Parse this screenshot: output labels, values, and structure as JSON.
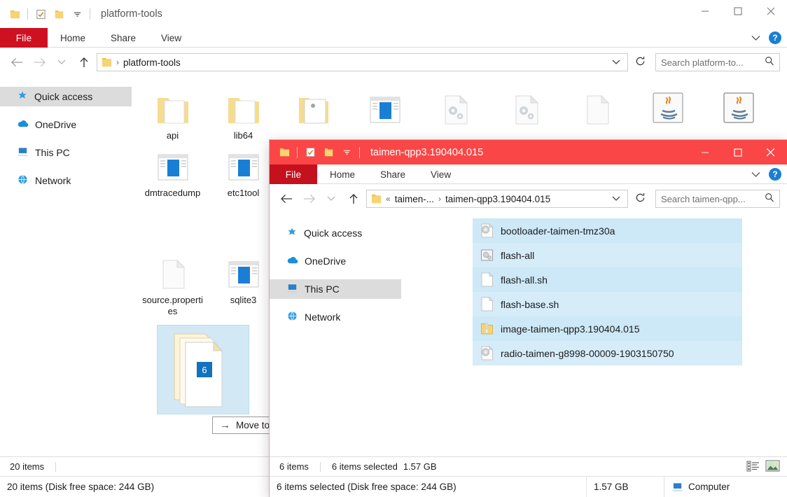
{
  "colors": {
    "accent_red_titlebar": "#fa4646",
    "file_tab_red": "#cf1020",
    "file_tab_red_front": "#c5101d",
    "selection_blue": "#cde8f7",
    "nav_selected_gray": "#dcdcdc"
  },
  "window_back": {
    "title": "platform-tools",
    "tabs": {
      "file": "File",
      "home": "Home",
      "share": "Share",
      "view": "View"
    },
    "controls": {
      "minimize": "–",
      "maximize": "□",
      "close": "✕"
    },
    "help_label": "?",
    "address": {
      "crumb_root_icon": "folder-icon",
      "separator": "›",
      "path": "platform-tools"
    },
    "search": {
      "placeholder": "Search platform-to..."
    },
    "nav": {
      "items": [
        {
          "label": "Quick access",
          "icon": "star-icon",
          "selected": true
        },
        {
          "label": "OneDrive",
          "icon": "cloud-icon",
          "selected": false
        },
        {
          "label": "This PC",
          "icon": "computer-icon",
          "selected": false
        },
        {
          "label": "Network",
          "icon": "network-icon",
          "selected": false
        }
      ]
    },
    "files": [
      {
        "name": "api",
        "icon": "folder-icon"
      },
      {
        "name": "lib64",
        "icon": "folder-icon"
      },
      {
        "name": "",
        "icon": "folder-open-icon"
      },
      {
        "name": "",
        "icon": "blue-book-icon"
      },
      {
        "name": "",
        "icon": "gears-document-icon"
      },
      {
        "name": "",
        "icon": "gears-document-icon"
      },
      {
        "name": "",
        "icon": "blank-document-icon"
      },
      {
        "name": "",
        "icon": "java-icon"
      },
      {
        "name": "",
        "icon": "java-icon"
      },
      {
        "name": "dmtracedump",
        "icon": "blue-book-icon"
      },
      {
        "name": "etc1tool",
        "icon": "blue-book-icon"
      },
      {
        "name": "source.properties",
        "icon": "blank-document-icon"
      },
      {
        "name": "sqlite3",
        "icon": "blue-book-icon"
      }
    ],
    "status": {
      "items_count": "20 items"
    },
    "taskbar": {
      "text": "20 items (Disk free space: 244 GB)"
    }
  },
  "window_front": {
    "title": "taimen-qpp3.190404.015",
    "tabs": {
      "file": "File",
      "home": "Home",
      "share": "Share",
      "view": "View"
    },
    "controls": {
      "minimize": "–",
      "maximize": "□",
      "close": "✕"
    },
    "help_label": "?",
    "address": {
      "overflow": "«",
      "parent": "taimen-...",
      "separator": "›",
      "path": "taimen-qpp3.190404.015"
    },
    "search": {
      "placeholder": "Search taimen-qpp..."
    },
    "nav": {
      "items": [
        {
          "label": "Quick access",
          "icon": "star-icon",
          "selected": false
        },
        {
          "label": "OneDrive",
          "icon": "cloud-icon",
          "selected": false
        },
        {
          "label": "This PC",
          "icon": "computer-icon",
          "selected": true
        },
        {
          "label": "Network",
          "icon": "network-icon",
          "selected": false
        }
      ]
    },
    "files": [
      {
        "name": "bootloader-taimen-tmz30a",
        "icon": "disc-document-icon",
        "selected": true
      },
      {
        "name": "flash-all",
        "icon": "batch-script-icon",
        "selected": true
      },
      {
        "name": "flash-all.sh",
        "icon": "blank-document-icon",
        "selected": true
      },
      {
        "name": "flash-base.sh",
        "icon": "blank-document-icon",
        "selected": true
      },
      {
        "name": "image-taimen-qpp3.190404.015",
        "icon": "zip-folder-icon",
        "selected": true
      },
      {
        "name": "radio-taimen-g8998-00009-1903150750",
        "icon": "disc-document-icon",
        "selected": true
      }
    ],
    "status": {
      "items_count": "6 items",
      "selected_count": "6 items selected",
      "selected_size": "1.57 GB"
    },
    "view_toggles": [
      {
        "icon": "details-view-icon",
        "active": false
      },
      {
        "icon": "large-icons-view-icon",
        "active": true
      }
    ],
    "taskbar": {
      "left": "6 items selected (Disk free space: 244 GB)",
      "size": "1.57 GB",
      "location_icon": "computer-icon",
      "location": "Computer"
    }
  },
  "drag": {
    "badge_count": "6",
    "tooltip_arrow": "→",
    "tooltip_text": "Move to platform-tools"
  }
}
